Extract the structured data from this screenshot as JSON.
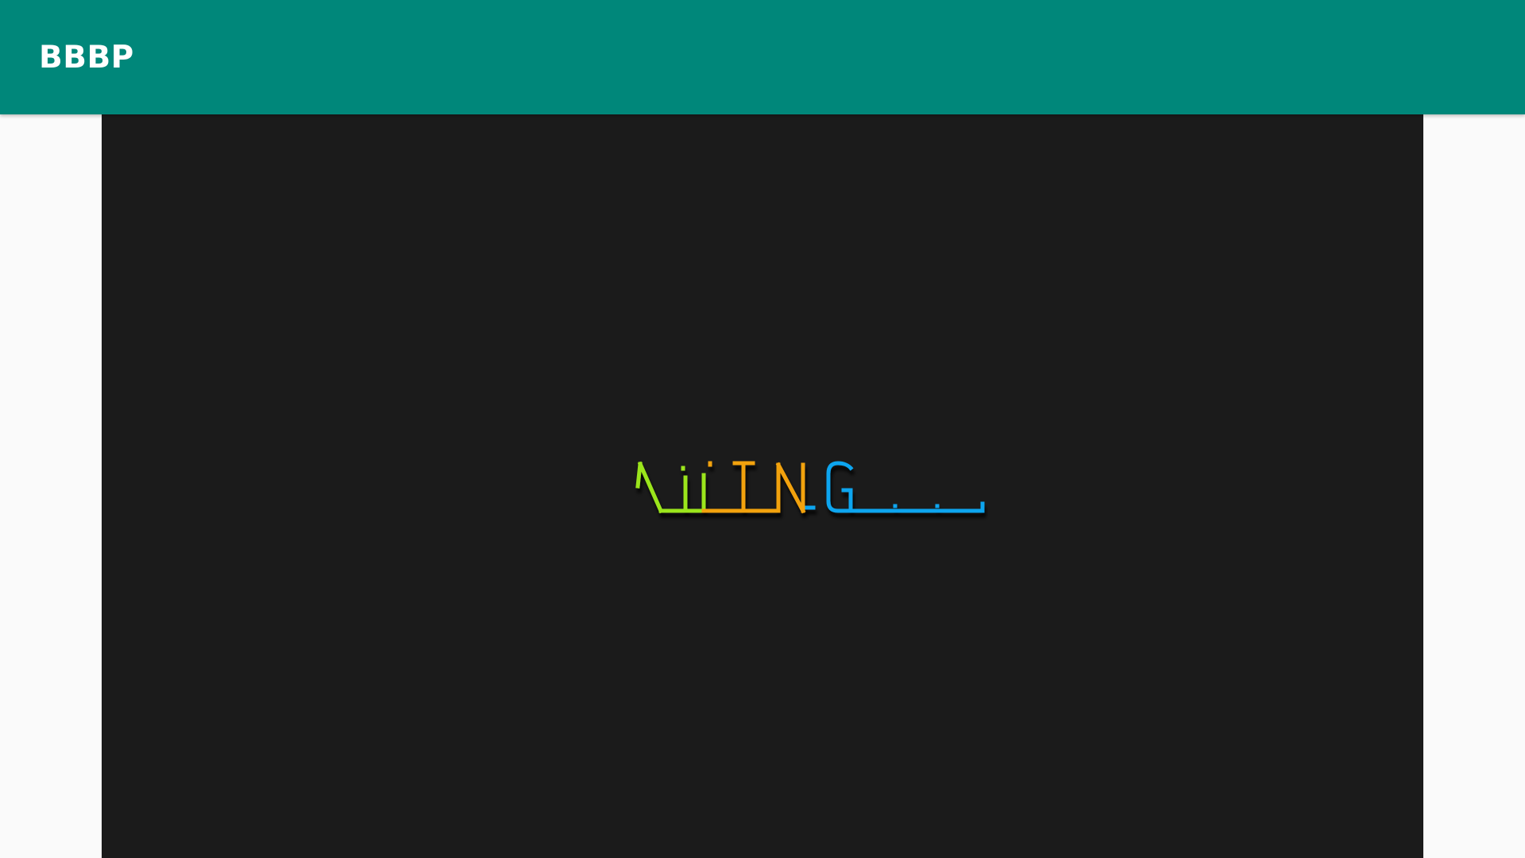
{
  "app": {
    "title": "BBBP"
  },
  "loader": {
    "colors": {
      "green": "#9be51a",
      "orange": "#f2a20c",
      "blue": "#0aa5ef"
    }
  }
}
